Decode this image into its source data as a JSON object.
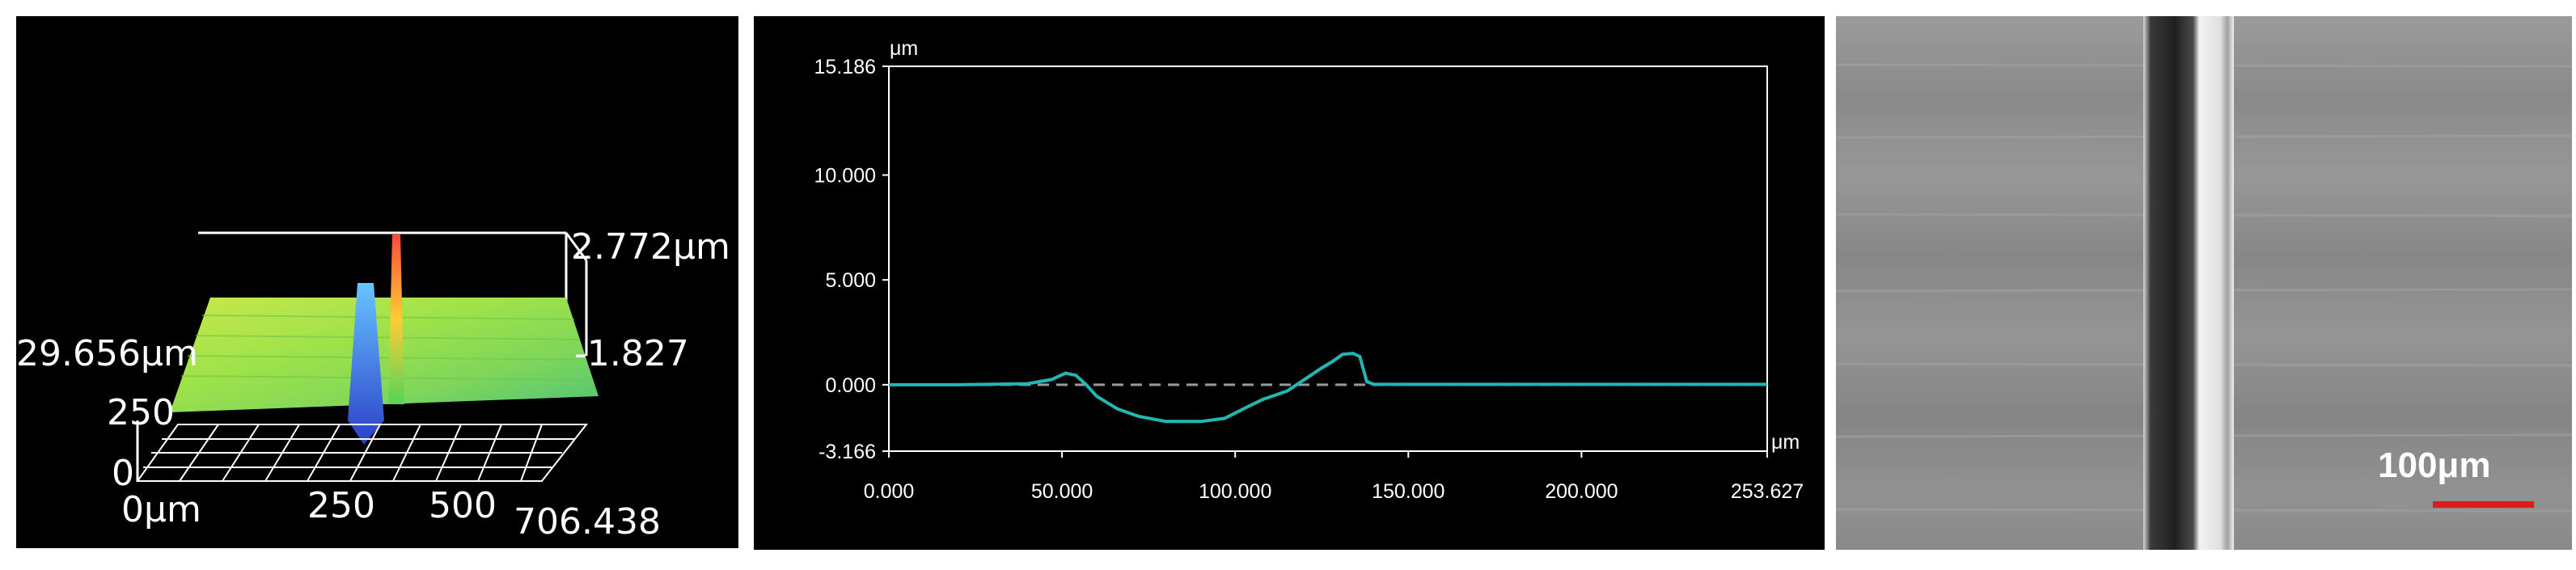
{
  "chart_data": [
    {
      "type": "surface3d",
      "x_tick_labels": [
        "0μm",
        "250",
        "500",
        "706.438"
      ],
      "y_tick_labels": [
        "0",
        "250",
        "29.656μm"
      ],
      "z_tick_labels": [
        "2.772μm",
        "-1.827"
      ]
    },
    {
      "type": "line",
      "y_unit": "μm",
      "x_unit": "μm",
      "xlim": [
        0,
        253.627
      ],
      "ylim": [
        -3.166,
        15.186
      ],
      "x_tick_labels": [
        "0.000",
        "50.000",
        "100.000",
        "150.000",
        "200.000",
        "253.627"
      ],
      "y_tick_labels": [
        "15.186",
        "10.000",
        "5.000",
        "0.000",
        "-3.166"
      ],
      "y_ticks": [
        15.186,
        10,
        5,
        0,
        -3.166
      ],
      "x_ticks": [
        0,
        50,
        100,
        150,
        200,
        253.627
      ],
      "reference_line": 0,
      "line_color": "#22b7b4",
      "series": [
        {
          "x": [
            0,
            20,
            40,
            47,
            51,
            54,
            57,
            60,
            66,
            72,
            80,
            90,
            97,
            103,
            108,
            115,
            120,
            125,
            128,
            131,
            134,
            136,
            138,
            140,
            150,
            175,
            200,
            230,
            253.627
          ],
          "y": [
            0,
            0,
            0.05,
            0.25,
            0.55,
            0.45,
            0.0,
            -0.55,
            -1.15,
            -1.5,
            -1.75,
            -1.75,
            -1.6,
            -1.1,
            -0.7,
            -0.3,
            0.25,
            0.8,
            1.1,
            1.45,
            1.5,
            1.35,
            0.15,
            0.02,
            0.02,
            0.02,
            0.02,
            0.02,
            0.02
          ]
        }
      ]
    },
    {
      "type": "image",
      "scale_bar_label": "100μm",
      "scale_bar_color": "#e11919"
    }
  ]
}
